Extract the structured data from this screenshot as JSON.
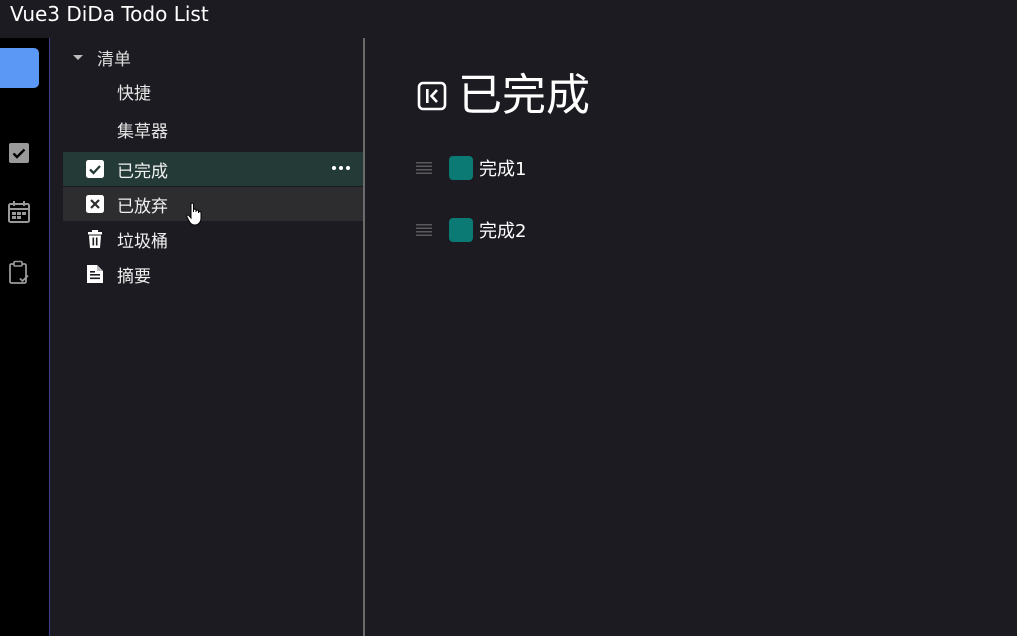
{
  "app": {
    "title": "Vue3 DiDa Todo List"
  },
  "sidebar": {
    "group_label": "清单",
    "sub_items": [
      {
        "label": "快捷"
      },
      {
        "label": "集草器"
      }
    ],
    "items": [
      {
        "label": "已完成",
        "icon": "check-square-icon",
        "selected": true
      },
      {
        "label": "已放弃",
        "icon": "x-square-icon"
      },
      {
        "label": "垃圾桶",
        "icon": "trash-icon"
      },
      {
        "label": "摘要",
        "icon": "document-icon"
      }
    ]
  },
  "main": {
    "title": "已完成",
    "tasks": [
      {
        "label": "完成1",
        "status": "completed"
      },
      {
        "label": "完成2",
        "status": "completed"
      }
    ]
  },
  "colors": {
    "accent": "#5b98f5",
    "task_check": "#0b7a75",
    "selected_row": "#233a36",
    "hover_row": "#2d2d30"
  }
}
